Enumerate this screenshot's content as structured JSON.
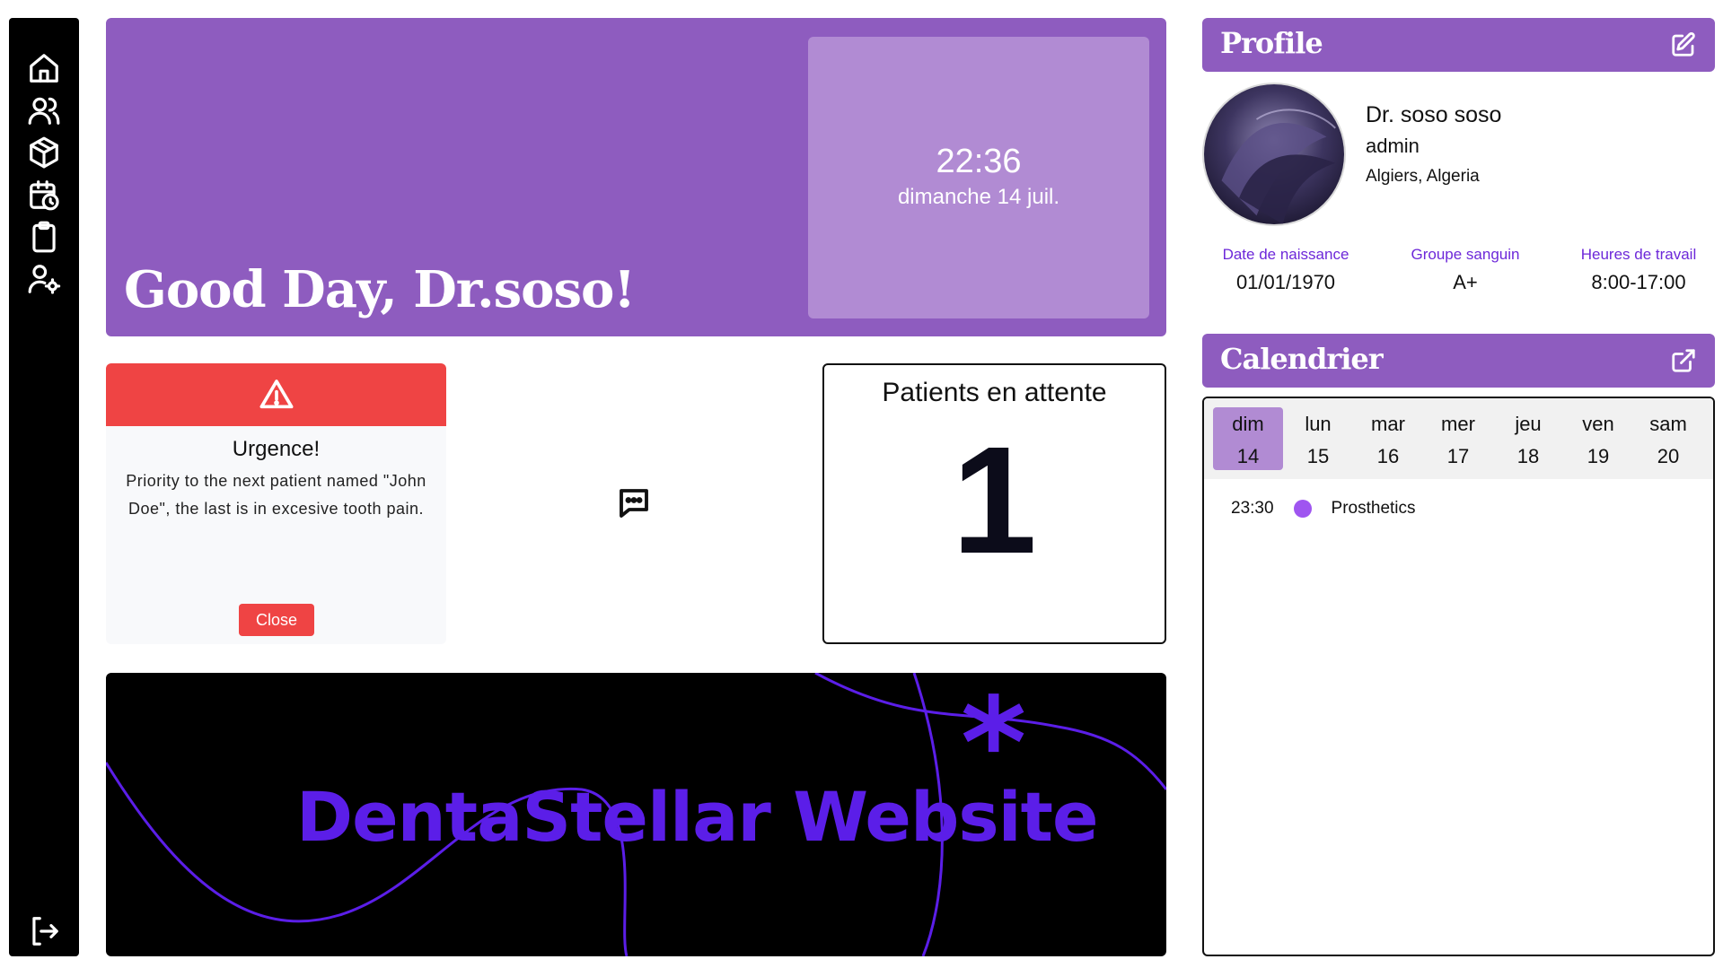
{
  "sidebar": {
    "items": [
      {
        "name": "home-icon"
      },
      {
        "name": "users-icon"
      },
      {
        "name": "box-icon"
      },
      {
        "name": "calendar-clock-icon"
      },
      {
        "name": "clipboard-icon"
      },
      {
        "name": "user-settings-icon"
      }
    ],
    "logout": {
      "name": "logout-icon"
    }
  },
  "hero": {
    "greeting": "Good Day, Dr.soso!",
    "time": "22:36",
    "date": "dimanche 14 juil."
  },
  "urgence": {
    "title": "Urgence!",
    "message": "Priority to the next patient named \"John Doe\", the last is in excesive tooth pain.",
    "close_label": "Close",
    "color": "#ef4444"
  },
  "waiting": {
    "title": "Patients en attente",
    "count": "1"
  },
  "banner": {
    "text": "DentaStellar Website",
    "accent": "#5b1ee8"
  },
  "profile": {
    "header": "Profile",
    "name": "Dr. soso soso",
    "role": "admin",
    "location": "Algiers, Algeria",
    "stats": [
      {
        "label": "Date de naissance",
        "value": "01/01/1970"
      },
      {
        "label": "Groupe sanguin",
        "value": "A+"
      },
      {
        "label": "Heures de travail",
        "value": "8:00-17:00"
      }
    ]
  },
  "calendar": {
    "header": "Calendrier",
    "days": [
      {
        "name": "dim",
        "num": "14",
        "active": true
      },
      {
        "name": "lun",
        "num": "15"
      },
      {
        "name": "mar",
        "num": "16"
      },
      {
        "name": "mer",
        "num": "17"
      },
      {
        "name": "jeu",
        "num": "18"
      },
      {
        "name": "ven",
        "num": "19"
      },
      {
        "name": "sam",
        "num": "20"
      }
    ],
    "events": [
      {
        "time": "23:30",
        "title": "Prosthetics",
        "color": "#9f55f0"
      }
    ]
  },
  "theme": {
    "primary": "#8e5cbf",
    "primary_light": "#b18bd3",
    "danger": "#ef4444",
    "link": "#6d28d9"
  }
}
